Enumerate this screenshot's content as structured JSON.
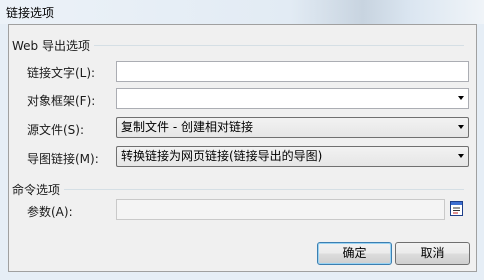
{
  "window": {
    "title": "链接选项"
  },
  "web_export": {
    "heading": "Web 导出选项",
    "link_text": {
      "label": "链接文字(L):",
      "value": ""
    },
    "target_frame": {
      "label": "对象框架(F):",
      "value": ""
    },
    "source_file": {
      "label": "源文件(S):",
      "value": "复制文件 - 创建相对链接"
    },
    "map_link": {
      "label": "导图链接(M):",
      "value": "转换链接为网页链接(链接导出的导图)"
    }
  },
  "command": {
    "heading": "命令选项",
    "params": {
      "label": "参数(A):",
      "value": ""
    }
  },
  "buttons": {
    "ok": "确定",
    "cancel": "取消"
  },
  "icons": {
    "dropdown": "chevron-down-icon",
    "browse": "browse-icon"
  }
}
